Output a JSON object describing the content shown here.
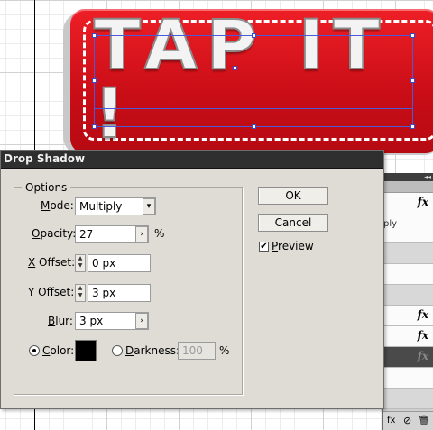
{
  "artwork": {
    "text": "TAP IT !"
  },
  "dialog": {
    "title": "Drop Shadow",
    "options_legend": "Options",
    "mode": {
      "label_u": "M",
      "label_rest": "ode:",
      "value": "Multiply"
    },
    "opacity": {
      "label_u": "O",
      "label_rest": "pacity:",
      "value": "27",
      "unit": "%"
    },
    "x_offset": {
      "label_u": "X",
      "label_rest": " Offset:",
      "value": "0 px"
    },
    "y_offset": {
      "label_u": "Y",
      "label_rest": " Offset:",
      "value": "3 px"
    },
    "blur": {
      "label_u": "B",
      "label_rest": "lur:",
      "value": "3 px"
    },
    "color": {
      "label_u": "C",
      "label_rest": "olor:",
      "selected": true,
      "swatch": "#000000"
    },
    "darkness": {
      "label_u": "D",
      "label_rest": "arkness:",
      "value": "100",
      "unit": "%"
    },
    "ok_label": "OK",
    "cancel_label": "Cancel",
    "preview": {
      "label_u": "P",
      "label_rest": "review",
      "checked": true
    }
  },
  "panel": {
    "fx_label": "fx",
    "partial_text": "ply"
  },
  "colors": {
    "badge_red": "#e5141c",
    "selection": "#4a5ad8"
  }
}
